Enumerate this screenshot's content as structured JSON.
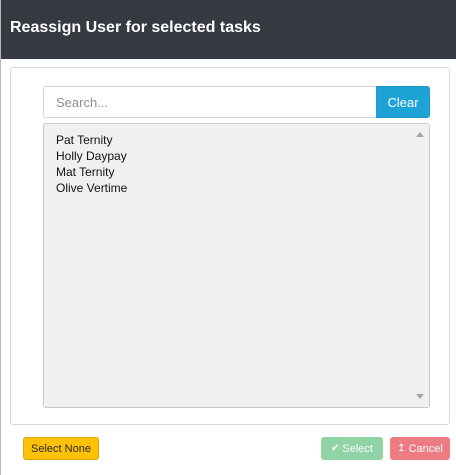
{
  "dialog": {
    "title": "Reassign User for selected tasks"
  },
  "search": {
    "placeholder": "Search...",
    "value": "",
    "clear_label": "Clear"
  },
  "users": [
    {
      "name": "Pat Ternity"
    },
    {
      "name": "Holly Daypay"
    },
    {
      "name": "Mat Ternity"
    },
    {
      "name": "Olive Vertime"
    }
  ],
  "footer": {
    "select_none_label": "Select None",
    "select_label": "Select",
    "select_icon": "check-icon",
    "cancel_label": "Cancel",
    "cancel_icon": "arrow-up-icon"
  },
  "colors": {
    "header_bg": "#343a40",
    "clear_button": "#1ea3d6",
    "select_none_button": "#ffc107",
    "select_button_disabled": "#8fd3a6",
    "cancel_button": "#ee7a82"
  }
}
